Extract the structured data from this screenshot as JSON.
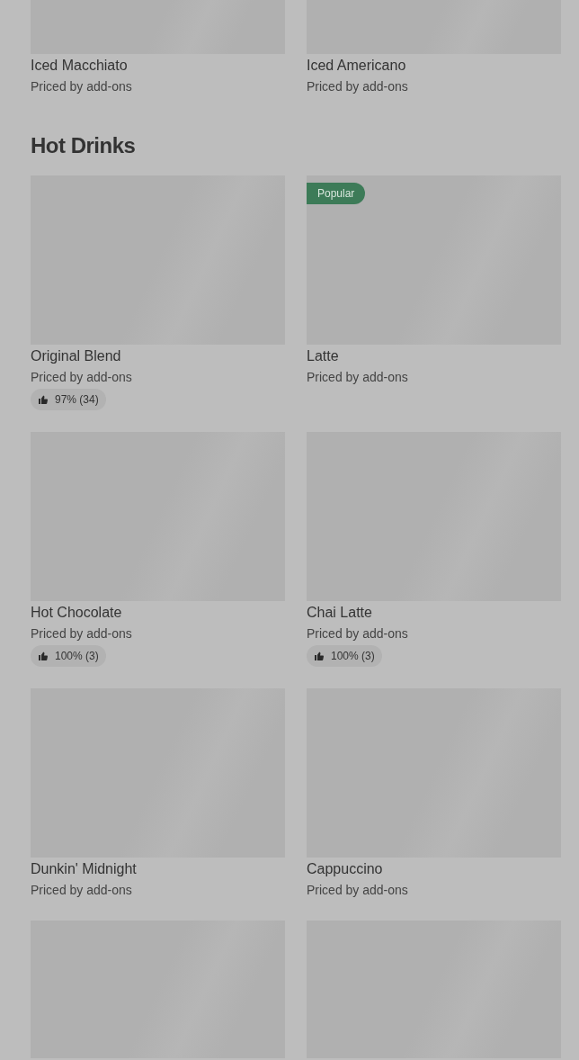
{
  "previous_section": {
    "items": [
      {
        "kind": "full",
        "name": "Iced Macchiato",
        "price": "Priced by add-ons"
      },
      {
        "kind": "full",
        "name": "Iced Americano",
        "price": "Priced by add-ons"
      }
    ]
  },
  "section": {
    "title": "Hot Drinks",
    "rows": [
      {
        "items": [
          {
            "kind": "full",
            "name": "Original Blend",
            "price": "Priced by add-ons",
            "rating": "97% (34)"
          },
          {
            "kind": "full",
            "name": "Latte",
            "price": "Priced by add-ons",
            "badge": "Popular"
          }
        ]
      },
      {
        "items": [
          {
            "kind": "full",
            "name": "Hot Chocolate",
            "price": "Priced by add-ons",
            "rating": "100% (3)"
          },
          {
            "kind": "full",
            "name": "Chai Latte",
            "price": "Priced by add-ons",
            "rating": "100% (3)"
          }
        ]
      },
      {
        "items": [
          {
            "kind": "full",
            "name": "Dunkin' Midnight",
            "price": "Priced by add-ons"
          },
          {
            "kind": "full",
            "name": "Cappuccino",
            "price": "Priced by add-ons"
          }
        ]
      },
      {
        "items": [
          {
            "kind": "image_only"
          },
          {
            "kind": "image_only"
          }
        ]
      }
    ]
  }
}
